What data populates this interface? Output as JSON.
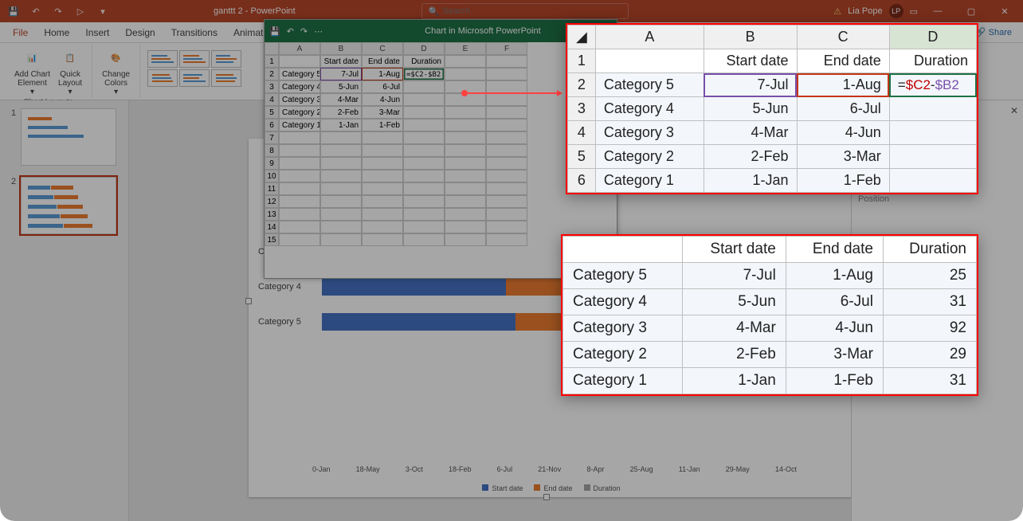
{
  "app_suffix": " - PowerPoint",
  "doc_name": "ganttt 2",
  "search_placeholder": "Search",
  "user_name": "Lia Pope",
  "user_initials": "LP",
  "tabs": [
    "File",
    "Home",
    "Insert",
    "Design",
    "Transitions",
    "Animations"
  ],
  "share_label": "Share",
  "ribbon": {
    "add_chart_element": "Add Chart\nElement",
    "quick_layout": "Quick\nLayout",
    "change_colors": "Change\nColors",
    "group_layouts": "Chart Layouts"
  },
  "excel_window_title": "Chart in Microsoft PowerPoint",
  "excel_cols": [
    "A",
    "B",
    "C",
    "D",
    "E",
    "F"
  ],
  "excel_hdr": {
    "b": "Start date",
    "c": "End date",
    "d": "Duration"
  },
  "excel_rows": [
    {
      "n": 2,
      "a": "Category 5",
      "b": "7-Jul",
      "c": "1-Aug",
      "d": "=$C2-$B2"
    },
    {
      "n": 3,
      "a": "Category 4",
      "b": "5-Jun",
      "c": "6-Jul",
      "d": ""
    },
    {
      "n": 4,
      "a": "Category 3",
      "b": "4-Mar",
      "c": "4-Jun",
      "d": ""
    },
    {
      "n": 5,
      "a": "Category 2",
      "b": "2-Feb",
      "c": "3-Mar",
      "d": ""
    },
    {
      "n": 6,
      "a": "Category 1",
      "b": "1-Jan",
      "c": "1-Feb",
      "d": ""
    }
  ],
  "zoom1": {
    "cols": [
      "A",
      "B",
      "C",
      "D"
    ],
    "hdr": {
      "b": "Start date",
      "c": "End date",
      "d": "Duration"
    },
    "formula_parts": [
      "=",
      "$C2",
      "-",
      "$B2"
    ],
    "rows": [
      {
        "n": 2,
        "a": "Category 5",
        "b": "7-Jul",
        "c": "1-Aug"
      },
      {
        "n": 3,
        "a": "Category 4",
        "b": "5-Jun",
        "c": "6-Jul"
      },
      {
        "n": 4,
        "a": "Category 3",
        "b": "4-Mar",
        "c": "4-Jun"
      },
      {
        "n": 5,
        "a": "Category 2",
        "b": "2-Feb",
        "c": "3-Mar"
      },
      {
        "n": 6,
        "a": "Category 1",
        "b": "1-Jan",
        "c": "1-Feb"
      }
    ]
  },
  "zoom2": {
    "hdr": {
      "b": "Start date",
      "c": "End date",
      "d": "Duration"
    },
    "rows": [
      {
        "a": "Category 5",
        "b": "7-Jul",
        "c": "1-Aug",
        "d": 25
      },
      {
        "a": "Category 4",
        "b": "5-Jun",
        "c": "6-Jul",
        "d": 31
      },
      {
        "a": "Category 3",
        "b": "4-Mar",
        "c": "4-Jun",
        "d": 92
      },
      {
        "a": "Category 2",
        "b": "2-Feb",
        "c": "3-Mar",
        "d": 29
      },
      {
        "a": "Category 1",
        "b": "1-Jan",
        "c": "1-Feb",
        "d": 31
      }
    ]
  },
  "chart": {
    "categories_visible": [
      "Category 3",
      "Category 4",
      "Category 5"
    ],
    "x_ticks": [
      "0-Jan",
      "18-May",
      "3-Oct",
      "18-Feb",
      "6-Jul",
      "21-Nov",
      "8-Apr",
      "25-Aug",
      "11-Jan",
      "29-May",
      "14-Oct"
    ],
    "legend": [
      "Start date",
      "End date",
      "Duration"
    ],
    "legend_colors": [
      "#4472c4",
      "#ed7d31",
      "#a5a5a5"
    ]
  },
  "format_pane": {
    "heading": "Position"
  },
  "chart_data": {
    "type": "bar",
    "note": "Gantt-style stacked bar; Start/End encoded as serial-date offsets, Duration computed",
    "categories": [
      "Category 1",
      "Category 2",
      "Category 3",
      "Category 4",
      "Category 5"
    ],
    "series": [
      {
        "name": "Start date",
        "values": [
          "1-Jan",
          "2-Feb",
          "4-Mar",
          "5-Jun",
          "7-Jul"
        ]
      },
      {
        "name": "End date",
        "values": [
          "1-Feb",
          "3-Mar",
          "4-Jun",
          "6-Jul",
          "1-Aug"
        ]
      },
      {
        "name": "Duration",
        "values": [
          31,
          29,
          92,
          31,
          25
        ]
      }
    ],
    "title": "",
    "xlabel": "",
    "ylabel": "",
    "x_ticks": [
      "0-Jan",
      "18-May",
      "3-Oct",
      "18-Feb",
      "6-Jul",
      "21-Nov",
      "8-Apr",
      "25-Aug",
      "11-Jan",
      "29-May",
      "14-Oct"
    ]
  }
}
